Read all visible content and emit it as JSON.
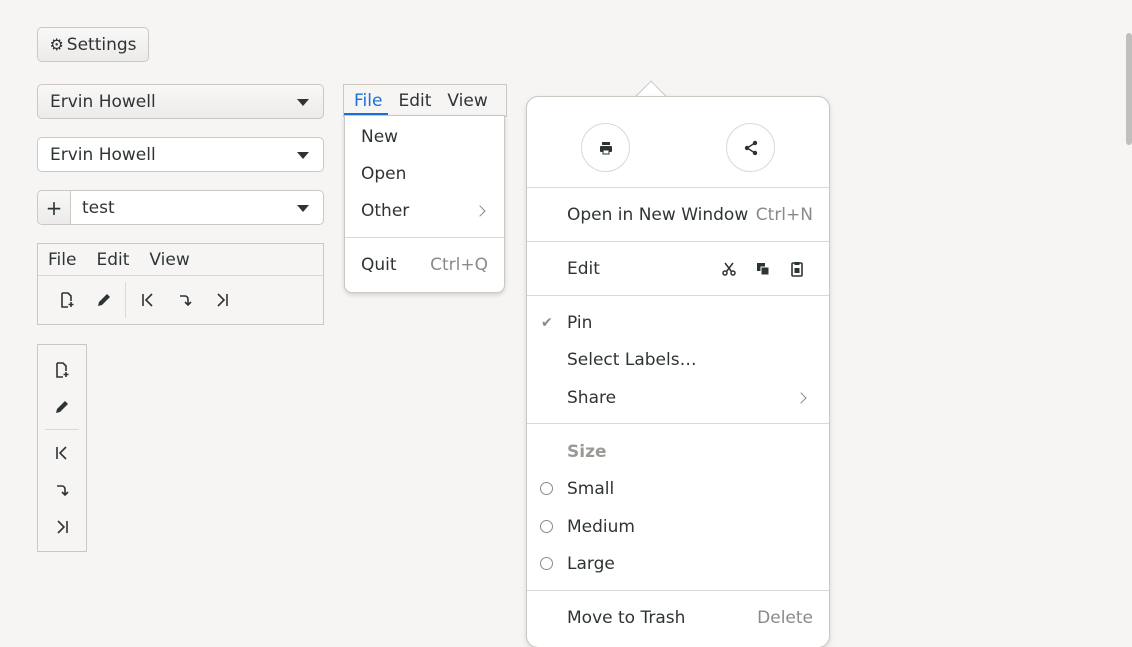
{
  "settings_button": {
    "label": "Settings",
    "icon": "gear-icon"
  },
  "combos": [
    {
      "value": "Ervin Howell"
    },
    {
      "value": "Ervin Howell"
    },
    {
      "value": "test",
      "add_icon": "+"
    }
  ],
  "left_menubar": {
    "items": [
      "File",
      "Edit",
      "View"
    ]
  },
  "toolbar_icons": [
    "document-new-icon",
    "edit-pencil-icon",
    "go-first-icon",
    "jump-icon",
    "go-last-icon"
  ],
  "middle_menubar": {
    "items": [
      "File",
      "Edit",
      "View"
    ],
    "active": "File"
  },
  "file_menu": {
    "items": [
      {
        "label": "New"
      },
      {
        "label": "Open"
      },
      {
        "label": "Other",
        "submenu": true
      }
    ],
    "quit": {
      "label": "Quit",
      "accel": "Ctrl+Q"
    }
  },
  "popover": {
    "top_buttons": [
      "print-icon",
      "share-icon"
    ],
    "open_new_window": {
      "label": "Open in New Window",
      "accel": "Ctrl+N"
    },
    "edit": {
      "label": "Edit",
      "icons": [
        "cut-icon",
        "copy-icon",
        "paste-icon"
      ]
    },
    "pin": {
      "label": "Pin",
      "checked": true
    },
    "select_labels": "Select Labels…",
    "share": "Share",
    "size_title": "Size",
    "sizes": [
      "Small",
      "Medium",
      "Large"
    ],
    "trash": {
      "label": "Move to Trash",
      "accel": "Delete"
    }
  }
}
